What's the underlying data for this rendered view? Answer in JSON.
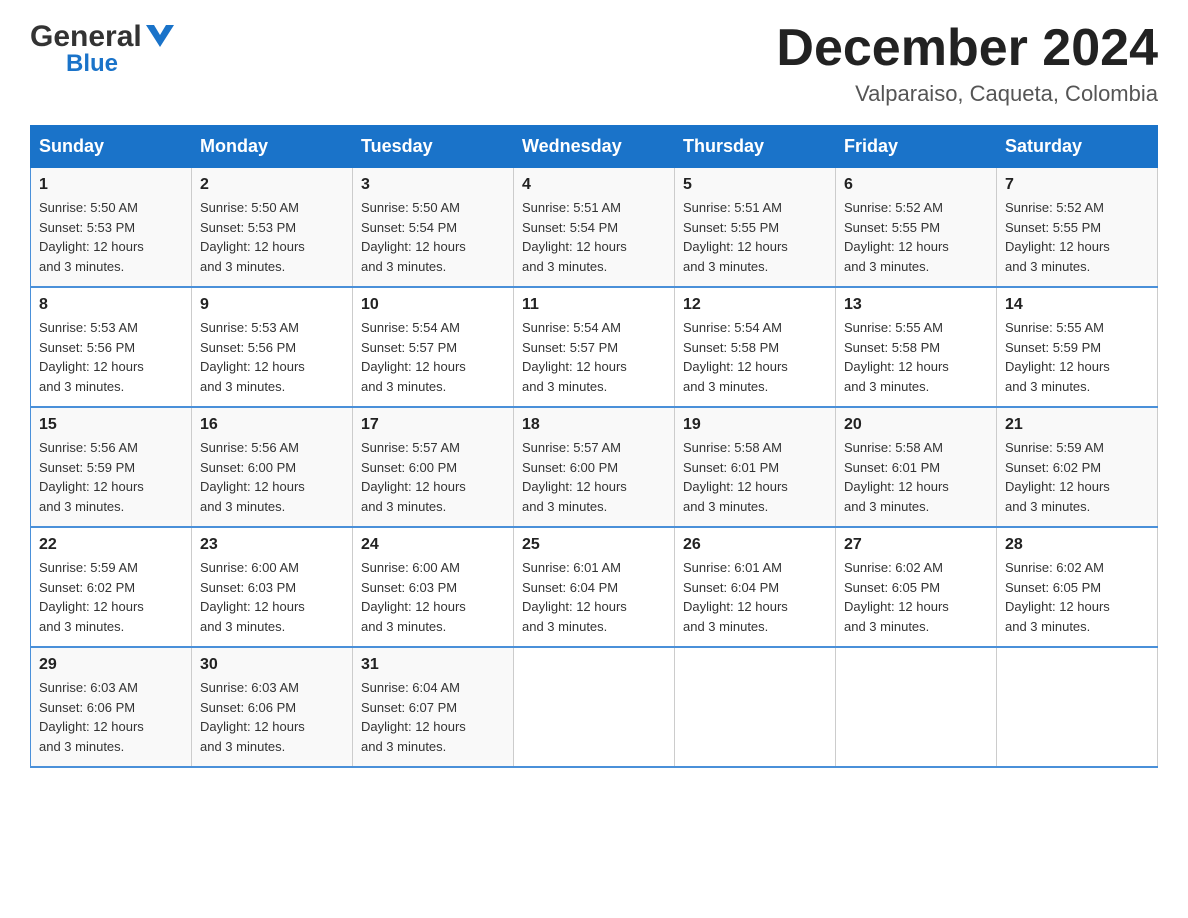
{
  "header": {
    "logo_general": "General",
    "logo_blue": "Blue",
    "month_title": "December 2024",
    "location": "Valparaiso, Caqueta, Colombia"
  },
  "days_of_week": [
    "Sunday",
    "Monday",
    "Tuesday",
    "Wednesday",
    "Thursday",
    "Friday",
    "Saturday"
  ],
  "weeks": [
    [
      {
        "day": "1",
        "sunrise": "5:50 AM",
        "sunset": "5:53 PM",
        "daylight": "12 hours and 3 minutes."
      },
      {
        "day": "2",
        "sunrise": "5:50 AM",
        "sunset": "5:53 PM",
        "daylight": "12 hours and 3 minutes."
      },
      {
        "day": "3",
        "sunrise": "5:50 AM",
        "sunset": "5:54 PM",
        "daylight": "12 hours and 3 minutes."
      },
      {
        "day": "4",
        "sunrise": "5:51 AM",
        "sunset": "5:54 PM",
        "daylight": "12 hours and 3 minutes."
      },
      {
        "day": "5",
        "sunrise": "5:51 AM",
        "sunset": "5:55 PM",
        "daylight": "12 hours and 3 minutes."
      },
      {
        "day": "6",
        "sunrise": "5:52 AM",
        "sunset": "5:55 PM",
        "daylight": "12 hours and 3 minutes."
      },
      {
        "day": "7",
        "sunrise": "5:52 AM",
        "sunset": "5:55 PM",
        "daylight": "12 hours and 3 minutes."
      }
    ],
    [
      {
        "day": "8",
        "sunrise": "5:53 AM",
        "sunset": "5:56 PM",
        "daylight": "12 hours and 3 minutes."
      },
      {
        "day": "9",
        "sunrise": "5:53 AM",
        "sunset": "5:56 PM",
        "daylight": "12 hours and 3 minutes."
      },
      {
        "day": "10",
        "sunrise": "5:54 AM",
        "sunset": "5:57 PM",
        "daylight": "12 hours and 3 minutes."
      },
      {
        "day": "11",
        "sunrise": "5:54 AM",
        "sunset": "5:57 PM",
        "daylight": "12 hours and 3 minutes."
      },
      {
        "day": "12",
        "sunrise": "5:54 AM",
        "sunset": "5:58 PM",
        "daylight": "12 hours and 3 minutes."
      },
      {
        "day": "13",
        "sunrise": "5:55 AM",
        "sunset": "5:58 PM",
        "daylight": "12 hours and 3 minutes."
      },
      {
        "day": "14",
        "sunrise": "5:55 AM",
        "sunset": "5:59 PM",
        "daylight": "12 hours and 3 minutes."
      }
    ],
    [
      {
        "day": "15",
        "sunrise": "5:56 AM",
        "sunset": "5:59 PM",
        "daylight": "12 hours and 3 minutes."
      },
      {
        "day": "16",
        "sunrise": "5:56 AM",
        "sunset": "6:00 PM",
        "daylight": "12 hours and 3 minutes."
      },
      {
        "day": "17",
        "sunrise": "5:57 AM",
        "sunset": "6:00 PM",
        "daylight": "12 hours and 3 minutes."
      },
      {
        "day": "18",
        "sunrise": "5:57 AM",
        "sunset": "6:00 PM",
        "daylight": "12 hours and 3 minutes."
      },
      {
        "day": "19",
        "sunrise": "5:58 AM",
        "sunset": "6:01 PM",
        "daylight": "12 hours and 3 minutes."
      },
      {
        "day": "20",
        "sunrise": "5:58 AM",
        "sunset": "6:01 PM",
        "daylight": "12 hours and 3 minutes."
      },
      {
        "day": "21",
        "sunrise": "5:59 AM",
        "sunset": "6:02 PM",
        "daylight": "12 hours and 3 minutes."
      }
    ],
    [
      {
        "day": "22",
        "sunrise": "5:59 AM",
        "sunset": "6:02 PM",
        "daylight": "12 hours and 3 minutes."
      },
      {
        "day": "23",
        "sunrise": "6:00 AM",
        "sunset": "6:03 PM",
        "daylight": "12 hours and 3 minutes."
      },
      {
        "day": "24",
        "sunrise": "6:00 AM",
        "sunset": "6:03 PM",
        "daylight": "12 hours and 3 minutes."
      },
      {
        "day": "25",
        "sunrise": "6:01 AM",
        "sunset": "6:04 PM",
        "daylight": "12 hours and 3 minutes."
      },
      {
        "day": "26",
        "sunrise": "6:01 AM",
        "sunset": "6:04 PM",
        "daylight": "12 hours and 3 minutes."
      },
      {
        "day": "27",
        "sunrise": "6:02 AM",
        "sunset": "6:05 PM",
        "daylight": "12 hours and 3 minutes."
      },
      {
        "day": "28",
        "sunrise": "6:02 AM",
        "sunset": "6:05 PM",
        "daylight": "12 hours and 3 minutes."
      }
    ],
    [
      {
        "day": "29",
        "sunrise": "6:03 AM",
        "sunset": "6:06 PM",
        "daylight": "12 hours and 3 minutes."
      },
      {
        "day": "30",
        "sunrise": "6:03 AM",
        "sunset": "6:06 PM",
        "daylight": "12 hours and 3 minutes."
      },
      {
        "day": "31",
        "sunrise": "6:04 AM",
        "sunset": "6:07 PM",
        "daylight": "12 hours and 3 minutes."
      },
      null,
      null,
      null,
      null
    ]
  ],
  "labels": {
    "sunrise": "Sunrise:",
    "sunset": "Sunset:",
    "daylight": "Daylight:"
  }
}
